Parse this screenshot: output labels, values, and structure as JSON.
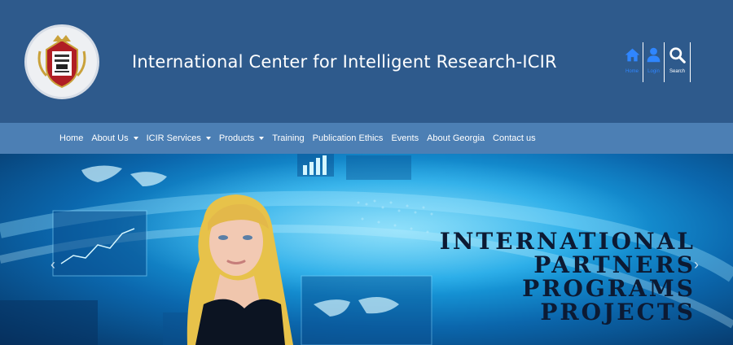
{
  "header": {
    "logo_alt": "International Center for Intelligent Research",
    "title": "International Center for Intelligent Research-ICIR",
    "icons": [
      {
        "name": "home-icon",
        "label": "Home"
      },
      {
        "name": "login-icon",
        "label": "Login"
      },
      {
        "name": "search-icon",
        "label": "Search"
      }
    ]
  },
  "nav": {
    "items": [
      {
        "label": "Home",
        "dropdown": false
      },
      {
        "label": "About Us",
        "dropdown": true
      },
      {
        "label": "ICIR Services",
        "dropdown": true
      },
      {
        "label": "Products",
        "dropdown": true
      },
      {
        "label": "Training",
        "dropdown": false
      },
      {
        "label": "Publication Ethics",
        "dropdown": false
      },
      {
        "label": "Events",
        "dropdown": false
      },
      {
        "label": "About Georgia",
        "dropdown": false
      },
      {
        "label": "Contact us",
        "dropdown": false
      }
    ]
  },
  "hero": {
    "lines": [
      "INTERNATIONAL",
      "PARTNERS",
      "PROGRAMS",
      "PROJECTS"
    ],
    "prev": "‹",
    "next": "›"
  },
  "colors": {
    "header_bg": "#2e5a8c",
    "nav_bg": "#4c7fb4",
    "icon_label": "#2f86ff"
  }
}
